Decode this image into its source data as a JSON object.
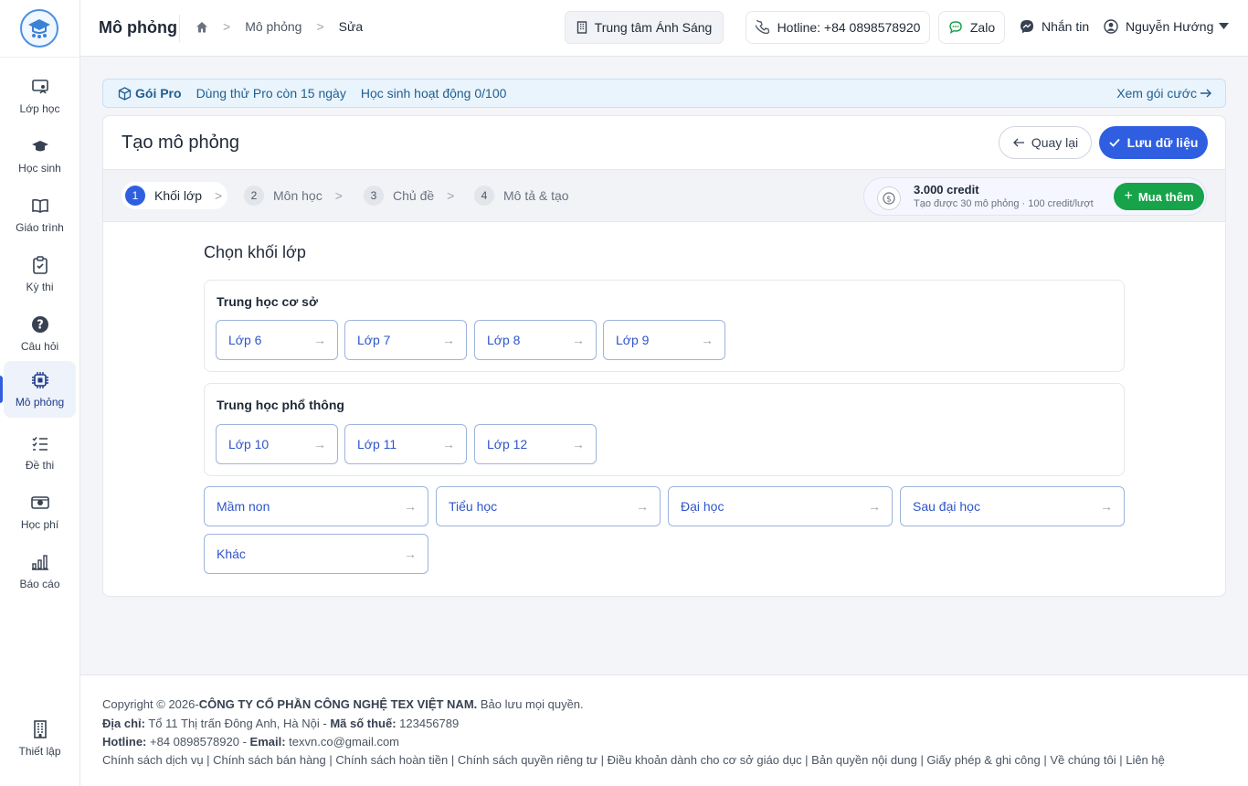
{
  "sidebar": {
    "items": [
      {
        "label": "Lớp học",
        "icon": "classroom-icon"
      },
      {
        "label": "Học sinh",
        "icon": "graduation-cap-icon"
      },
      {
        "label": "Giáo trình",
        "icon": "book-icon"
      },
      {
        "label": "Kỳ thi",
        "icon": "clipboard-check-icon"
      },
      {
        "label": "Câu hỏi",
        "icon": "question-circle-icon"
      },
      {
        "label": "Mô phỏng",
        "icon": "chip-icon"
      },
      {
        "label": "Đề thi",
        "icon": "list-check-icon"
      },
      {
        "label": "Học phí",
        "icon": "money-icon"
      },
      {
        "label": "Báo cáo",
        "icon": "bar-chart-icon"
      }
    ],
    "settings_label": "Thiết lập"
  },
  "header": {
    "title": "Mô phỏng",
    "breadcrumb": [
      "Mô phỏng",
      "Sửa"
    ],
    "center_name": "Trung tâm Ánh Sáng",
    "hotline": "Hotline: +84 0898578920",
    "zalo": "Zalo",
    "message": "Nhắn tin",
    "user": "Nguyễn Hướng"
  },
  "probar": {
    "plan": "Gói Pro",
    "trial": "Dùng thử Pro còn 15 ngày",
    "students": "Học sinh hoạt động 0/100",
    "link": "Xem gói cước"
  },
  "card": {
    "title": "Tạo mô phỏng",
    "back": "Quay lại",
    "save": "Lưu dữ liệu",
    "steps": [
      {
        "num": "1",
        "label": "Khối lớp"
      },
      {
        "num": "2",
        "label": "Môn học"
      },
      {
        "num": "3",
        "label": "Chủ đề"
      },
      {
        "num": "4",
        "label": "Mô tả & tạo"
      }
    ],
    "credit": {
      "amount": "3.000 credit",
      "sub": "Tạo được 30 mô phỏng · 100 credit/lượt",
      "buy": "Mua thêm"
    },
    "section_title": "Chọn khối lớp",
    "groups": [
      {
        "title": "Trung học cơ sở",
        "options": [
          "Lớp 6",
          "Lớp 7",
          "Lớp 8",
          "Lớp 9"
        ]
      },
      {
        "title": "Trung học phổ thông",
        "options": [
          "Lớp 10",
          "Lớp 11",
          "Lớp 12"
        ]
      }
    ],
    "others": [
      "Mầm non",
      "Tiểu học",
      "Đại học",
      "Sau đại học",
      "Khác"
    ]
  },
  "footer": {
    "copyright_prefix": "Copyright © 2026-",
    "company": "CÔNG TY CỔ PHẦN CÔNG NGHỆ TEX VIỆT NAM.",
    "rights": " Bảo lưu mọi quyền.",
    "address_label": "Địa chỉ:",
    "address": " Tổ 11 Thị trấn Đông Anh, Hà Nội - ",
    "tax_label": "Mã số thuế:",
    "tax": " 123456789",
    "hotline_label": "Hotline:",
    "hotline": " +84 0898578920 - ",
    "email_label": "Email:",
    "email": " texvn.co@gmail.com",
    "links": "Chính sách dịch vụ | Chính sách bán hàng | Chính sách hoàn tiền | Chính sách quyền riêng tư | Điều khoản dành cho cơ sở giáo dục | Bản quyền nội dung | Giấy phép & ghi công | Về chúng tôi | Liên hệ"
  },
  "colors": {
    "accent": "#2f5fe0",
    "buy": "#16a34a",
    "option_text": "#2f55c8"
  }
}
